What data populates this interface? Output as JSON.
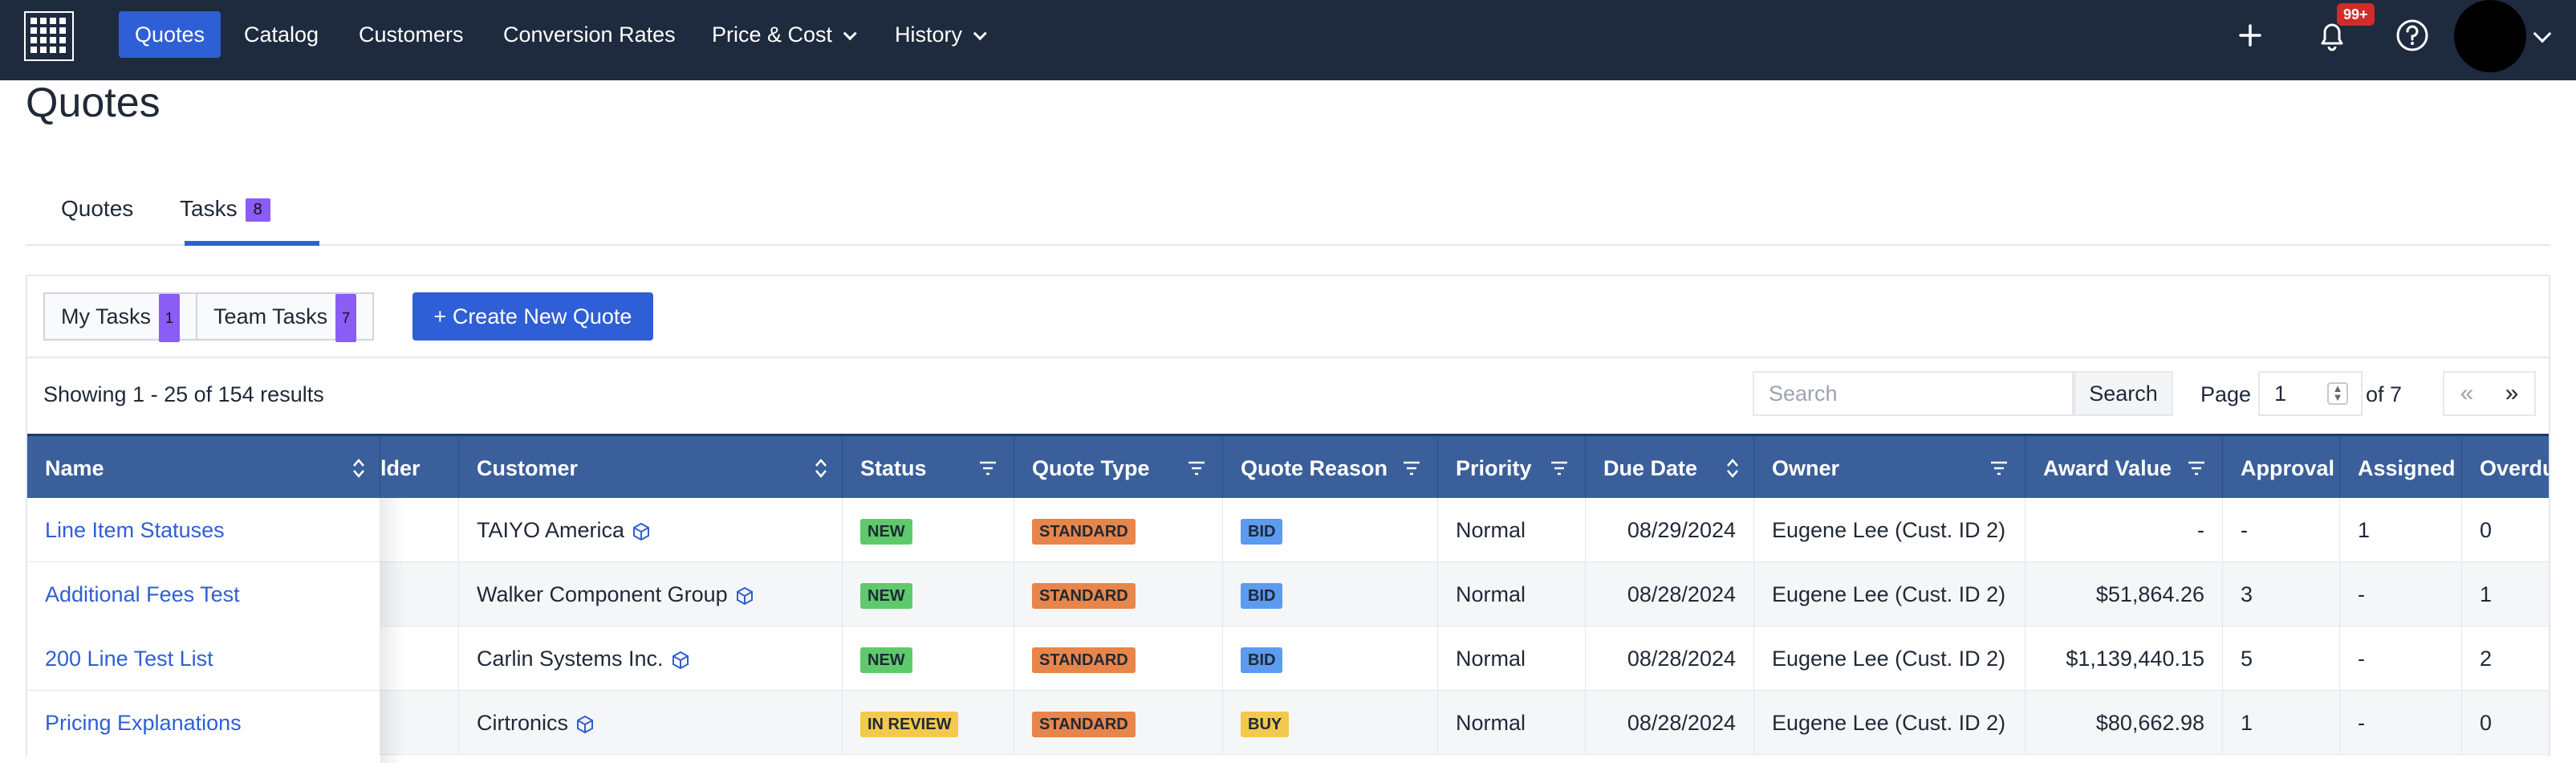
{
  "nav": {
    "items": [
      {
        "label": "Quotes",
        "active": true,
        "dropdown": false
      },
      {
        "label": "Catalog",
        "active": false,
        "dropdown": false
      },
      {
        "label": "Customers",
        "active": false,
        "dropdown": false
      },
      {
        "label": "Conversion Rates",
        "active": false,
        "dropdown": false
      },
      {
        "label": "Price & Cost",
        "active": false,
        "dropdown": true
      },
      {
        "label": "History",
        "active": false,
        "dropdown": true
      }
    ],
    "notifications_badge": "99+",
    "icons": [
      "grid-logo-icon",
      "plus-icon",
      "bell-icon",
      "help-icon",
      "avatar",
      "chevron-down-icon"
    ]
  },
  "page": {
    "title": "Quotes"
  },
  "tabs": [
    {
      "label": "Quotes",
      "count": null,
      "active": false
    },
    {
      "label": "Tasks",
      "count": "8",
      "active": true
    }
  ],
  "toolbar": {
    "my_tasks": {
      "label": "My Tasks",
      "count": "1"
    },
    "team_tasks": {
      "label": "Team Tasks",
      "count": "7"
    },
    "create_label": "+ Create New Quote"
  },
  "results": {
    "summary": "Showing 1 - 25 of 154 results",
    "search_placeholder": "Search",
    "search_button": "Search",
    "page_label": "Page",
    "page_value": "1",
    "of_label": "of 7",
    "prev": "«",
    "next": "»"
  },
  "table": {
    "columns": [
      "Name",
      "lder",
      "Customer",
      "Status",
      "Quote Type",
      "Quote Reason",
      "Priority",
      "Due Date",
      "Owner",
      "Award Value",
      "Approval",
      "Assigned",
      "Overdue"
    ],
    "rows": [
      {
        "name": "Line Item Statuses",
        "customer": "TAIYO America",
        "status": "NEW",
        "quote_type": "STANDARD",
        "quote_reason": "BID",
        "priority": "Normal",
        "due_date": "08/29/2024",
        "owner": "Eugene Lee (Cust. ID 2)",
        "award_value": "-",
        "approval": "-",
        "assigned": "1",
        "overdue": "0"
      },
      {
        "name": "Additional Fees Test",
        "customer": "Walker Component Group",
        "status": "NEW",
        "quote_type": "STANDARD",
        "quote_reason": "BID",
        "priority": "Normal",
        "due_date": "08/28/2024",
        "owner": "Eugene Lee (Cust. ID 2)",
        "award_value": "$51,864.26",
        "approval": "3",
        "assigned": "-",
        "overdue": "1"
      },
      {
        "name": "200 Line Test List",
        "customer": "Carlin Systems Inc.",
        "status": "NEW",
        "quote_type": "STANDARD",
        "quote_reason": "BID",
        "priority": "Normal",
        "due_date": "08/28/2024",
        "owner": "Eugene Lee (Cust. ID 2)",
        "award_value": "$1,139,440.15",
        "approval": "5",
        "assigned": "-",
        "overdue": "2"
      },
      {
        "name": "Pricing Explanations",
        "customer": "Cirtronics",
        "status": "IN REVIEW",
        "quote_type": "STANDARD",
        "quote_reason": "BUY",
        "priority": "Normal",
        "due_date": "08/28/2024",
        "owner": "Eugene Lee (Cust. ID 2)",
        "award_value": "$80,662.98",
        "approval": "1",
        "assigned": "-",
        "overdue": "0"
      }
    ]
  },
  "colors": {
    "nav_bg": "#1e2a3e",
    "accent": "#2f5fd6",
    "header_bg": "#3a5f9a",
    "badge_purple": "#8b5cf6",
    "new_green": "#5fca6b",
    "standard_orange": "#e8854a",
    "bid_blue": "#5b9bf0",
    "review_yellow": "#f2c94c"
  }
}
